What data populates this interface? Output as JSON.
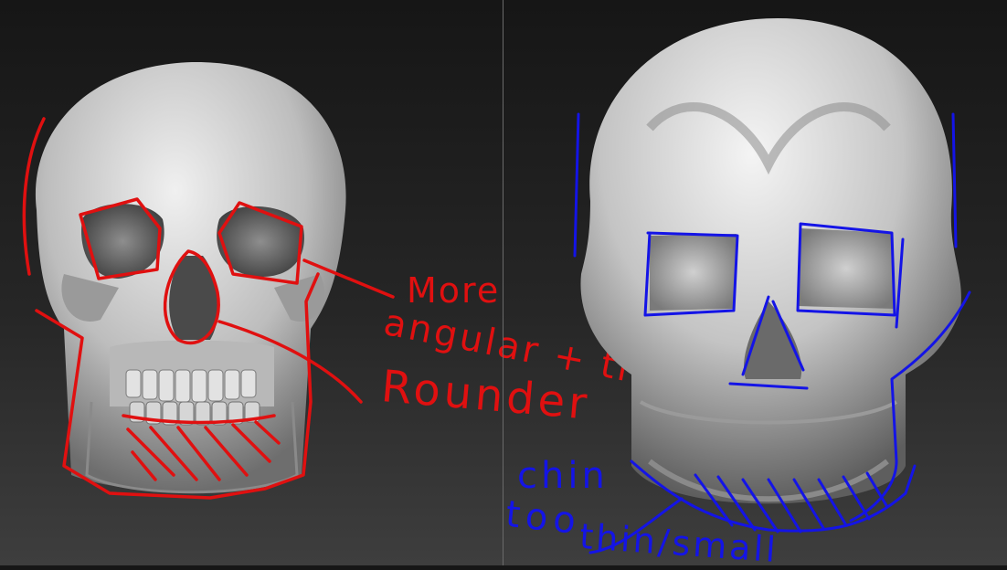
{
  "annotations": {
    "more": "More",
    "angular_tilted": "angular + tilted",
    "rounder": "Rounder",
    "chin": "chin",
    "too": "too",
    "thin_small": "thin/small"
  },
  "colors": {
    "red_ink": "#e01010",
    "blue_ink": "#1414e6",
    "bone": "#d8d8d8",
    "background_top": "#161616",
    "background_bottom": "#3e3e3e"
  },
  "panels": {
    "left": "reference skull",
    "right": "sculpted skull"
  }
}
